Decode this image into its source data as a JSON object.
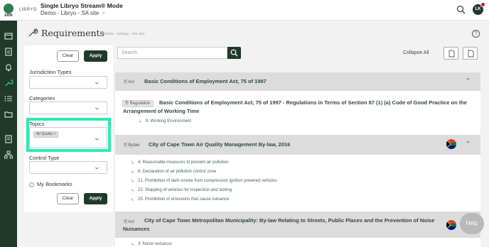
{
  "header": {
    "brand": "LIBRYO",
    "logo_text": "ERM",
    "app_title": "Single Libryo Stream® Mode",
    "site": "Demo - Libryo - SA site",
    "avatar_initials": "LK"
  },
  "page": {
    "title": "Requirements",
    "subtitle": "Demo - Libryo - SA site"
  },
  "filters": {
    "clear_label": "Clear",
    "apply_label": "Apply",
    "jurisdiction_label": "Jurisdiction Types",
    "categories_label": "Categories",
    "topics_label": "Topics",
    "topic_tag": "Air Quality",
    "topic_tag_remove": "×",
    "control_label": "Control Type",
    "bookmarks_label": "My Bookmarks"
  },
  "results": {
    "search_placeholder": "Search",
    "collapse_all": "Collapse All",
    "items": [
      {
        "type": "Act",
        "title": "Basic Conditions of Employment Act, 75 of 1997",
        "sub_type": "Regulation",
        "sub_title": "Basic Conditions of Employment Act, 75 of 1997 - Regulations in Terms of Section 87 (1) (a) Code of Good Practice on the Arrangement of Working Time",
        "links": [
          "9. Working Environment"
        ]
      },
      {
        "type": "Bylaw",
        "title": "City of Cape Town Air Quality Management By-law, 2016",
        "links": [
          "4. Reasonable measures to prevent air pollution",
          "8. Declaration of air pollution control zone",
          "21. Prohibition of dark smoke from compression ignition powered vehicles",
          "22. Stopping of vehicles for inspection and testing",
          "25. Prohibition of emissions that cause nuisance"
        ]
      },
      {
        "type": "Act",
        "title": "City of Cape Town Metropolitan Municipality: By-law Relating to Streets, Public Places and the Prevention of Noise Nuisances",
        "links": [
          "3. Noise nuisance"
        ]
      }
    ]
  },
  "help_label": "Help",
  "colors": {
    "brand_dark": "#1f3a2b",
    "highlight": "#2ee8b4",
    "link": "#3b6b50"
  }
}
